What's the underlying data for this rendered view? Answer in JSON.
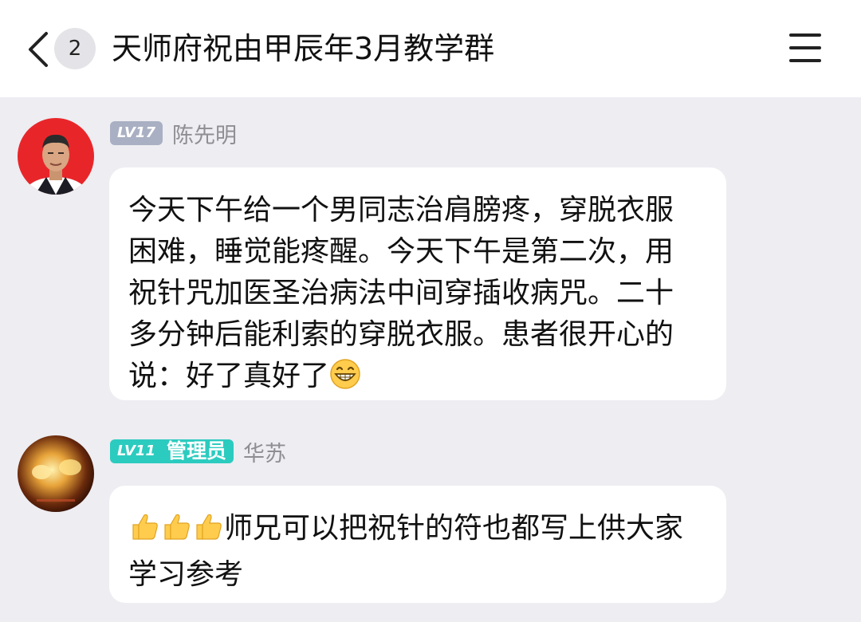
{
  "header": {
    "back_icon": "chevron-left-icon",
    "unread_count": "2",
    "title": "天师府祝由甲辰年3月教学群",
    "menu_icon": "hamburger-menu-icon"
  },
  "messages": [
    {
      "level": "LV17",
      "role": "",
      "username": "陈先明",
      "text": "今天下午给一个男同志治肩膀疼，穿脱衣服困难，睡觉能疼醒。今天下午是第二次，用祝针咒加医圣治病法中间穿插收病咒。二十多分钟后能利索的穿脱衣服。患者很开心的说：好了真好了",
      "trailing_emoji": "grinning-face-emoji"
    },
    {
      "level": "LV11",
      "role": "管理员",
      "username": "华苏",
      "leading_emoji": [
        "thumbs-up-emoji",
        "thumbs-up-emoji",
        "thumbs-up-emoji"
      ],
      "text": "师兄可以把祝针的符也都写上供大家学习参考"
    }
  ],
  "colors": {
    "background": "#ededf2",
    "bubble": "#ffffff",
    "level_gray": "#aab0c3",
    "level_teal": "#2ccbbf",
    "username": "#8e8e93"
  }
}
